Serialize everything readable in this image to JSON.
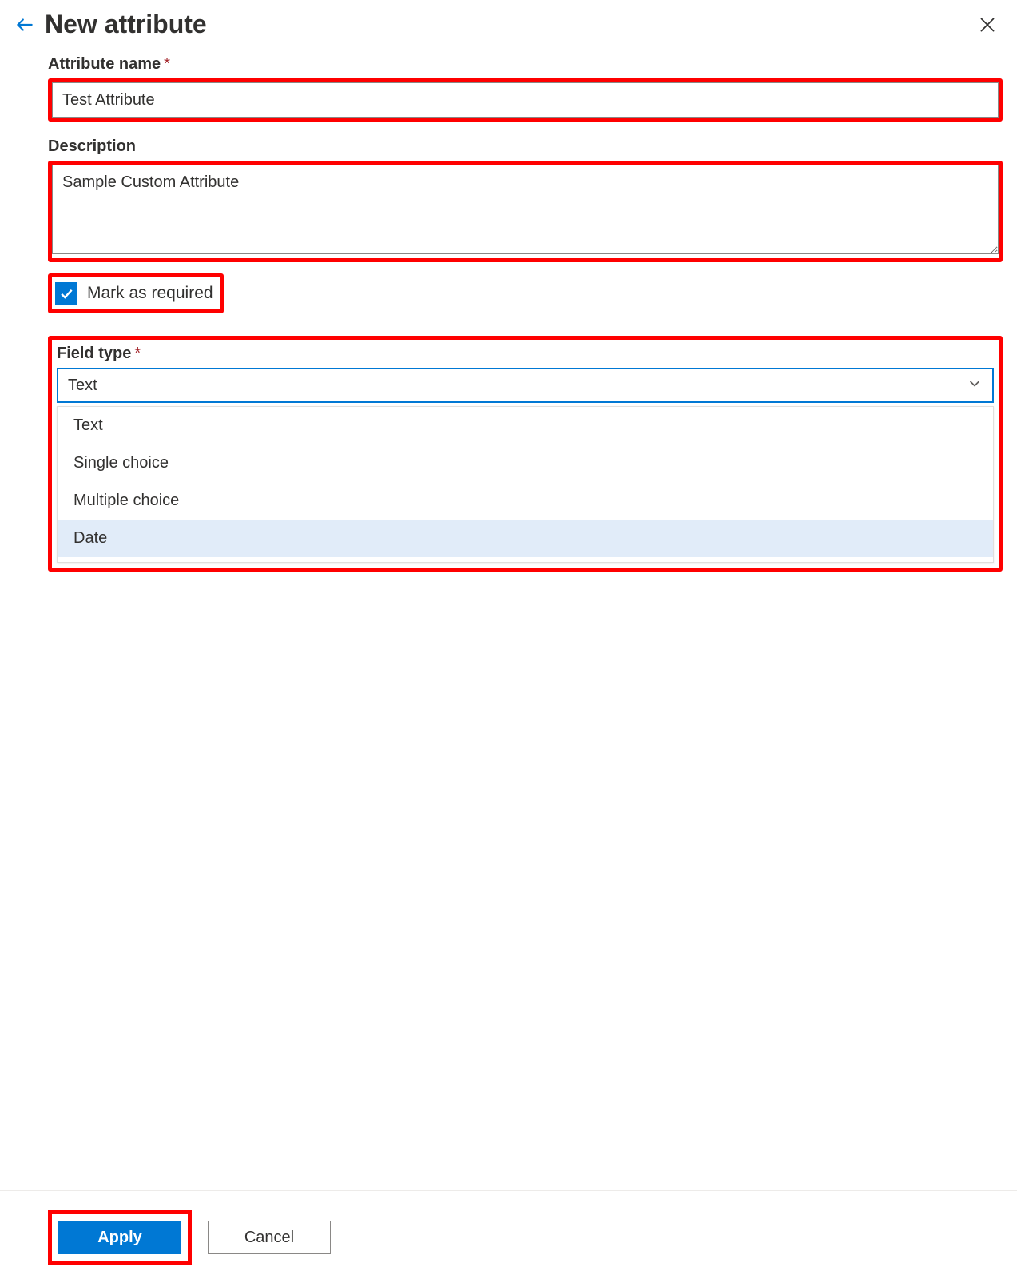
{
  "header": {
    "title": "New attribute"
  },
  "fields": {
    "attribute_name": {
      "label": "Attribute name",
      "value": "Test Attribute"
    },
    "description": {
      "label": "Description",
      "value": "Sample Custom Attribute"
    },
    "mark_required": {
      "label": "Mark as required",
      "checked": true
    },
    "field_type": {
      "label": "Field type",
      "selected": "Text",
      "options": [
        "Text",
        "Single choice",
        "Multiple choice",
        "Date"
      ],
      "hovered": "Date"
    }
  },
  "footer": {
    "apply": "Apply",
    "cancel": "Cancel"
  }
}
